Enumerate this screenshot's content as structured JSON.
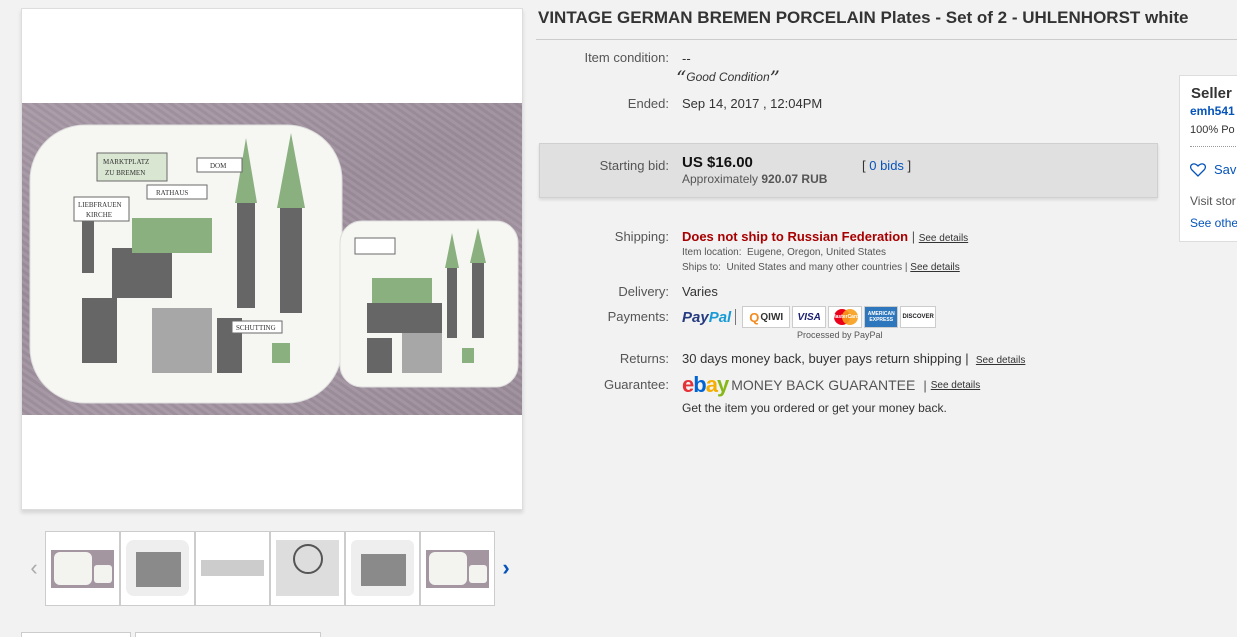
{
  "listing": {
    "title": "VINTAGE GERMAN BREMEN PORCELAIN Plates - Set of 2 - UHLENHORST white"
  },
  "details": {
    "condition_label": "Item condition:",
    "condition_value": "--",
    "condition_quote": "Good Condition",
    "ended_label": "Ended:",
    "ended_value": "Sep 14, 2017 , 12:04PM",
    "starting_bid_label": "Starting bid:",
    "starting_bid_value": "US $16.00",
    "approx_prefix": "Approximately",
    "approx_value": "920.07 RUB",
    "bids_link": "0 bids",
    "shipping_label": "Shipping:",
    "shipping_value": "Does not ship to Russian Federation",
    "shipping_see_details": "See details",
    "item_location_label": "Item location:",
    "item_location_value": "Eugene, Oregon, United States",
    "ships_to_label": "Ships to:",
    "ships_to_value": "United States and many other countries",
    "ships_to_see_details": "See details",
    "delivery_label": "Delivery:",
    "delivery_value": "Varies",
    "payments_label": "Payments:",
    "processed_by": "Processed by PayPal",
    "returns_label": "Returns:",
    "returns_value": "30 days money back, buyer pays return shipping",
    "returns_see_details": "See details",
    "guarantee_label": "Guarantee:",
    "guarantee_text": "MONEY BACK GUARANTEE",
    "guarantee_see_details": "See details",
    "guarantee_note": "Get the item you ordered or get your money back."
  },
  "payment_logos": {
    "paypal_a": "Pay",
    "paypal_b": "Pal",
    "qiwi": "QIWI",
    "visa": "VISA",
    "mastercard": "MasterCard",
    "amex": "AMERICAN EXPRESS",
    "discover": "DISCOVER"
  },
  "ebay_logo": {
    "e": "e",
    "b": "b",
    "a": "a",
    "y": "y"
  },
  "seller": {
    "heading": "Seller",
    "username": "emh541",
    "feedback": "100% Po",
    "save": "Sav",
    "visit_store": "Visit stor",
    "see_other": "See othe"
  },
  "photo_labels": {
    "marktplatz": "MARKTPLATZ",
    "zu_bremen": "ZU BREMEN",
    "dom": "DOM",
    "rathaus": "RATHAUS",
    "liebfrauen": "LIEBFRAUEN",
    "kirche": "KIRCHE",
    "schutting": "SCHUTTING"
  },
  "colors": {
    "link": "#0654ba",
    "alert_red": "#a80000",
    "bid_box": "#e0e0e0"
  }
}
